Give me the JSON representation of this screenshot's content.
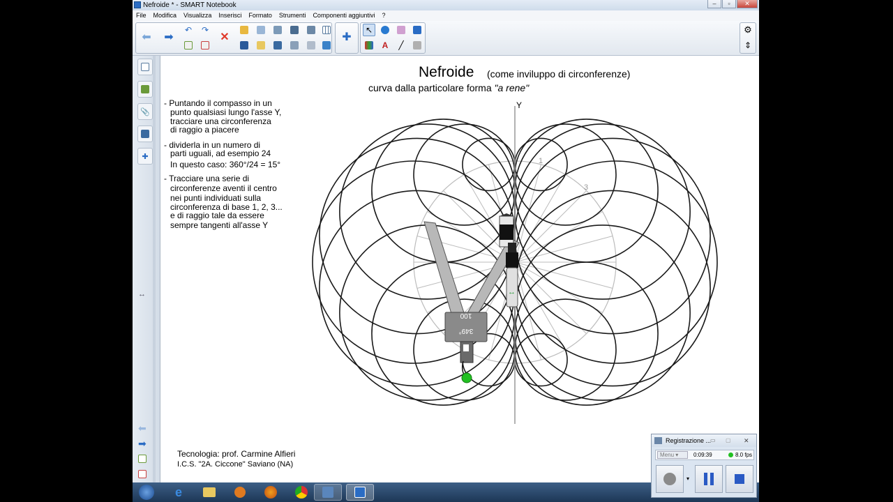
{
  "window": {
    "title": "Nefroide * - SMART Notebook"
  },
  "menu": [
    "File",
    "Modifica",
    "Visualizza",
    "Inserisci",
    "Formato",
    "Strumenti",
    "Componenti aggiuntivi",
    "?"
  ],
  "icons": {
    "app": "smart-notebook-icon",
    "back": "arrow-left-icon",
    "forward": "arrow-right-icon",
    "undo": "undo-icon",
    "redo": "redo-icon",
    "delete": "delete-x-icon",
    "select": "cursor-icon",
    "settings": "gear-icon",
    "move": "updown-arrows-icon"
  },
  "colors": {
    "accent": "#2a6cc4",
    "record_green": "#22c022",
    "compass_grey": "#8a8a8a",
    "circle": "#1a1a1a",
    "guide": "#bcbcbc"
  },
  "canvas": {
    "title": "Nefroide",
    "title_sub": "(come inviluppo di circonferenze)",
    "subtitle_prefix": "curva dalla particolare forma",
    "subtitle_italic": "\"a rene\"",
    "axis_label": "Y",
    "point_labels": [
      "1",
      "3"
    ],
    "compass_label_1": "100",
    "compass_label_2": "349°"
  },
  "instructions": [
    "- Puntando il compasso in un",
    "punto qualsiasi lungo l'asse Y,",
    "tracciare una circonferenza",
    "di raggio a piacere",
    "- dividerla in un  numero di",
    "parti uguali, ad esempio 24",
    "In questo caso: 360°/24 = 15°",
    "- Tracciare una serie di",
    "circonferenze aventi il centro",
    "nei punti individuati sulla",
    "circonferenza di base 1, 2, 3...",
    "e di raggio tale da essere",
    "sempre tangenti all'asse Y"
  ],
  "credits": {
    "line1": "Tecnologia: prof. Carmine Alfieri",
    "line2": "I.C.S. \"2A. Ciccone\" Saviano (NA)"
  },
  "recorder": {
    "title": "Registrazione ...",
    "menu": "Menu",
    "time": "0:09:39",
    "fps": "8.0 fps"
  }
}
